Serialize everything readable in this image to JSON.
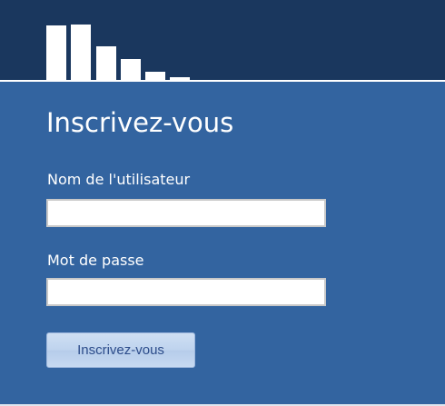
{
  "logo": {
    "bar_levels": [
      0.98,
      1.0,
      0.61,
      0.38,
      0.15,
      0.05
    ],
    "color": "#ffffff"
  },
  "colors": {
    "header": "#1a375e",
    "body": "#3364a0",
    "button": "#c6d9f1"
  },
  "form": {
    "title": "Inscrivez-vous",
    "username_label": "Nom de l'utilisateur",
    "username_value": "",
    "password_label": "Mot de passe",
    "password_value": "",
    "submit_label": "Inscrivez-vous"
  }
}
